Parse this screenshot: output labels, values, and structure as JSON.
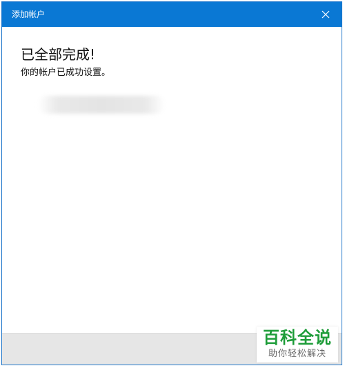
{
  "window": {
    "title": "添加帐户"
  },
  "main": {
    "heading": "已全部完成!",
    "message": "你的帐户已成功设置。"
  },
  "watermark": {
    "main_text": "百科全说",
    "sub_text": "助你轻松解决"
  },
  "colors": {
    "titlebar": "#0a78d4",
    "footer": "#e6e6e6",
    "watermark_green": "#1f9d3a"
  },
  "icons": {
    "close": "close-icon"
  }
}
